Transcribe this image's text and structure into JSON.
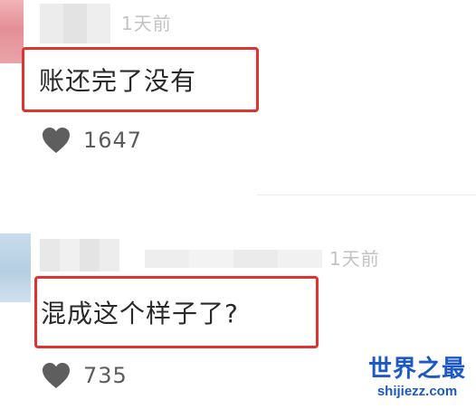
{
  "comments": [
    {
      "timestamp": "1天前",
      "text": "账还完了没有",
      "like_count": "1647"
    },
    {
      "timestamp": "1天前",
      "text": "混成这个样子了?",
      "like_count": "735"
    }
  ],
  "icons": {
    "like": "heart-icon"
  },
  "colors": {
    "highlight_border": "#e0322e",
    "watermark": "#1a59c7"
  },
  "watermark": {
    "title": "世界之最",
    "url": "shijiezz.com"
  }
}
